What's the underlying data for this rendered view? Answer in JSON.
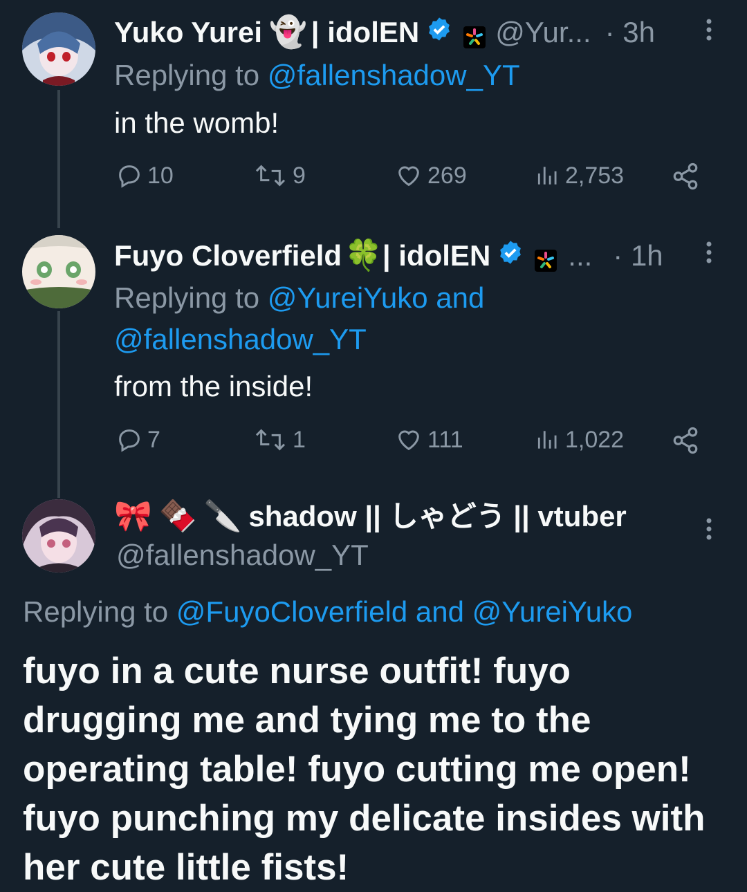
{
  "tweets": [
    {
      "name": "Yuko Yurei",
      "name_suffix": "| idolEN",
      "handle": "@Yur...",
      "time": "· 3h",
      "reply_prefix": "Replying to",
      "reply_to": "@fallenshadow_YT",
      "text": "in the womb!",
      "replies": "10",
      "reposts": "9",
      "likes": "269",
      "views": "2,753"
    },
    {
      "name": "Fuyo Cloverfield",
      "name_suffix": "| idolEN",
      "handle": "...",
      "time": "· 1h",
      "reply_prefix": "Replying to",
      "reply_to_line1": "@YureiYuko and",
      "reply_to_line2": "@fallenshadow_YT",
      "text": "from the inside!",
      "replies": "7",
      "reposts": "1",
      "likes": "111",
      "views": "1,022"
    }
  ],
  "main": {
    "name": "shadow || しゃどう || vtuber",
    "handle": "@fallenshadow_YT",
    "reply_prefix": "Replying to",
    "reply_to": "@FuyoCloverfield and @YureiYuko",
    "text": "fuyo in a cute nurse outfit! fuyo drugging me and tying me to the operating table! fuyo cutting me open! fuyo punching my delicate insides with her cute little fists!"
  },
  "icons": {
    "ghost": "ghost-emoji",
    "clover": "four-leaf-clover-emoji",
    "ribbon": "ribbon-emoji",
    "chocolate": "chocolate-bar-emoji",
    "knife": "knife-emoji"
  },
  "colors": {
    "background": "#15202b",
    "text": "#f7f9f9",
    "muted": "#8b98a5",
    "link": "#1d9bf0",
    "thread_line": "#38444d"
  }
}
